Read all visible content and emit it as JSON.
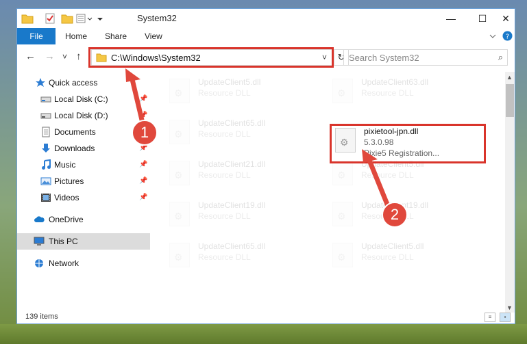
{
  "window": {
    "title": "System32",
    "min_glyph": "—",
    "max_glyph": "☐",
    "close_glyph": "✕"
  },
  "ribbon": {
    "file": "File",
    "tabs": [
      "Home",
      "Share",
      "View"
    ]
  },
  "nav": {
    "back": "←",
    "forward": "→",
    "recent": "˅",
    "up": "↑",
    "address": "C:\\Windows\\System32",
    "dropdown": "˅",
    "refresh": "↻",
    "search_placeholder": "Search System32",
    "search_glyph": "⌕"
  },
  "sidebar": {
    "items": [
      {
        "label": "Quick access",
        "icon": "star-icon"
      },
      {
        "label": "Local Disk (C:)",
        "icon": "drive-icon"
      },
      {
        "label": "Local Disk (D:)",
        "icon": "drive-icon"
      },
      {
        "label": "Documents",
        "icon": "documents-icon"
      },
      {
        "label": "Downloads",
        "icon": "download-icon"
      },
      {
        "label": "Music",
        "icon": "music-icon"
      },
      {
        "label": "Pictures",
        "icon": "pictures-icon"
      },
      {
        "label": "Videos",
        "icon": "videos-icon"
      },
      {
        "label": "OneDrive",
        "icon": "cloud-icon"
      },
      {
        "label": "This PC",
        "icon": "computer-icon"
      },
      {
        "label": "Network",
        "icon": "network-icon"
      }
    ],
    "pin_glyph": "📌"
  },
  "files": {
    "left": [
      {
        "name": "UpdateClient5.dll",
        "type": "Resource DLL"
      },
      {
        "name": "UpdateClient65.dll",
        "type": "Resource DLL"
      },
      {
        "name": "UpdateClient21.dll",
        "type": "Resource DLL"
      },
      {
        "name": "UpdateClient19.dll",
        "type": "Resource DLL"
      },
      {
        "name": "UpdateClient65.dll",
        "type": "Resource DLL"
      }
    ],
    "right": [
      {
        "name": "UpdateClient63.dll",
        "type": "Resource DLL"
      },
      {
        "name": "UpdateClient5.dll",
        "type": "Resource DLL"
      },
      {
        "name": "UpdateClient19.dll",
        "type": "Resource DLL"
      },
      {
        "name": "UpdateClient5.dll",
        "type": "Resource DLL"
      }
    ],
    "highlighted": {
      "name": "pixietool-jpn.dll",
      "version": "5.3.0.98",
      "description": "Pixie5 Registration..."
    }
  },
  "status": {
    "items": "139 items"
  },
  "annotations": {
    "step1": "1",
    "step2": "2",
    "color": "#e0483c"
  }
}
